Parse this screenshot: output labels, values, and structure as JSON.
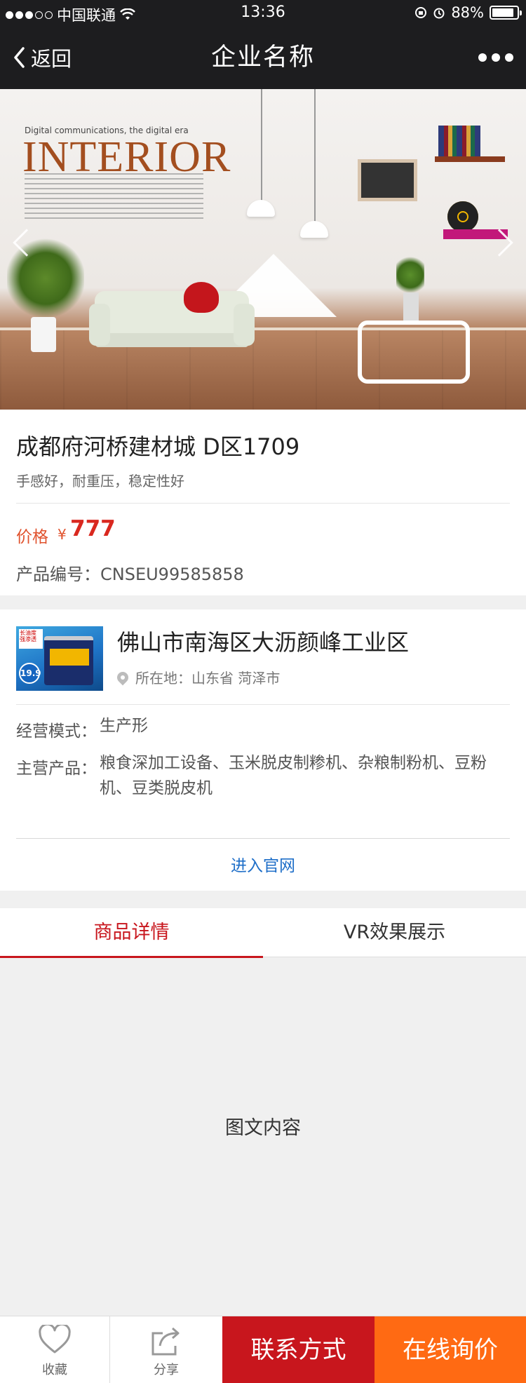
{
  "status_bar": {
    "carrier": "中国联通",
    "time": "13:36",
    "battery_percent": "88%",
    "battery_level": 0.88,
    "signal_bars_filled": 3,
    "signal_bars_total": 5
  },
  "nav": {
    "back_label": "返回",
    "title": "企业名称"
  },
  "banner": {
    "subtitle": "Digital communications, the digital era",
    "title": "INTERIOR"
  },
  "product": {
    "title": "成都府河桥建材城 D区1709",
    "subtitle": "手感好，耐重压，稳定性好",
    "price_label": "价格",
    "price_symbol": "¥",
    "price_value": "777",
    "code": "产品编号：CNSEU99585858"
  },
  "company": {
    "image_tag": "长油度 强渗透",
    "image_price": "19.9",
    "name": "佛山市南海区大沥颜峰工业区",
    "location": "所在地：山东省 菏泽市",
    "mode_label": "经营模式：",
    "mode_value": "生产形",
    "products_label": "主营产品：",
    "products_value": "粮食深加工设备、玉米脱皮制糁机、杂粮制粉机、豆粉机、豆类脱皮机",
    "website_link": "进入官网"
  },
  "tabs": [
    {
      "label": "商品详情",
      "active": true
    },
    {
      "label": "VR效果展示",
      "active": false
    }
  ],
  "content": {
    "placeholder": "图文内容"
  },
  "bottom_bar": {
    "favorite_label": "收藏",
    "share_label": "分享",
    "contact_label": "联系方式",
    "inquire_label": "在线询价"
  },
  "colors": {
    "nav_bg": "#1d1d1f",
    "accent_red": "#c8161d",
    "accent_orange": "#ff6a13",
    "price_red": "#d9281f",
    "link_blue": "#1e6ec8"
  }
}
